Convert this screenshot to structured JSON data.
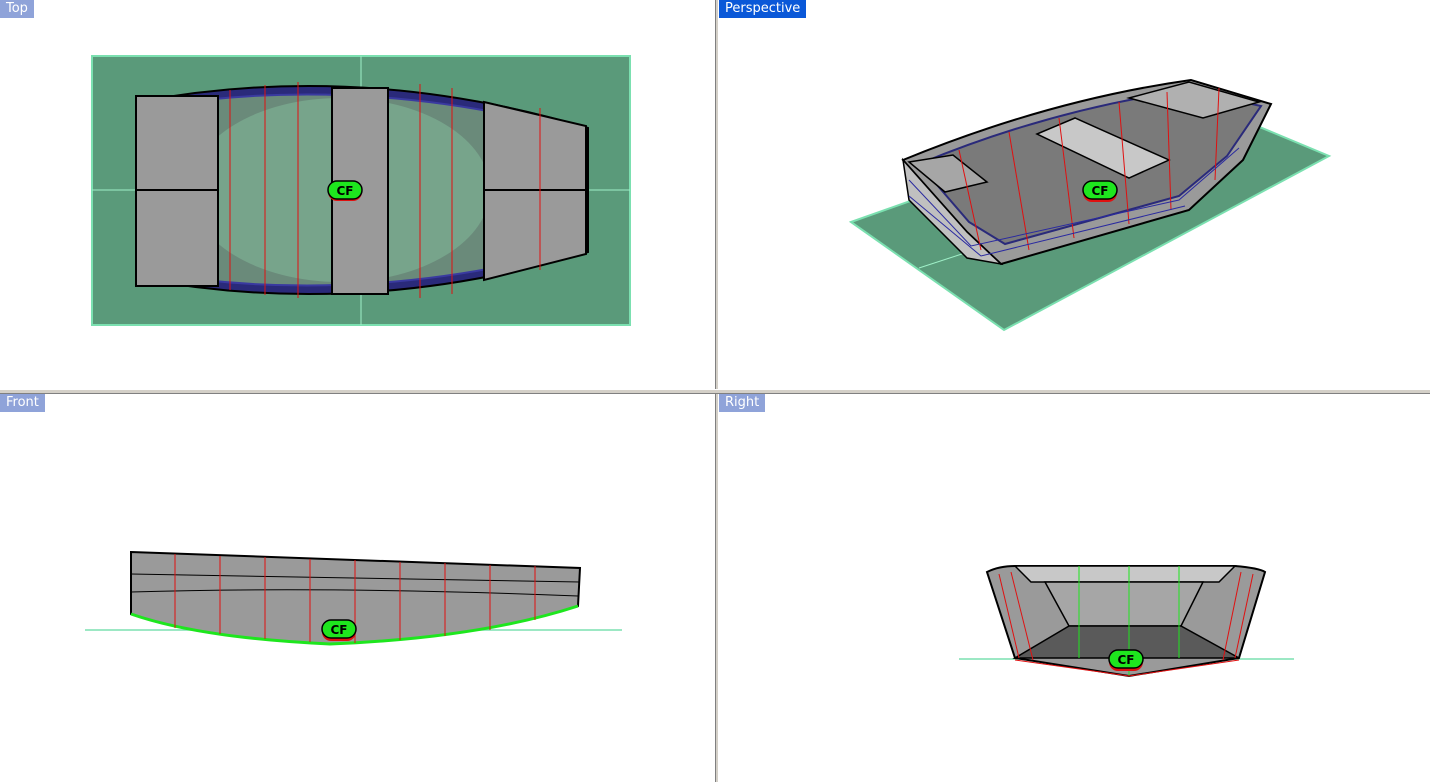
{
  "viewports": {
    "top": {
      "label": "Top"
    },
    "perspective": {
      "label": "Perspective"
    },
    "front": {
      "label": "Front"
    },
    "right": {
      "label": "Right"
    }
  },
  "marker": {
    "label": "CF"
  },
  "colors": {
    "hull": "#9a9a9a",
    "hull_light": "#c9c9c9",
    "hull_dark": "#6f6f6f",
    "plane": "#5a9a7a",
    "plane_edge": "#7be0b0",
    "marker_green": "#1ee61e",
    "marker_red": "#e01010",
    "viewport_label": "#8fa3d9",
    "viewport_label_active": "#0a58d8"
  },
  "icons": {
    "marker": "center-of-floatation-icon"
  }
}
